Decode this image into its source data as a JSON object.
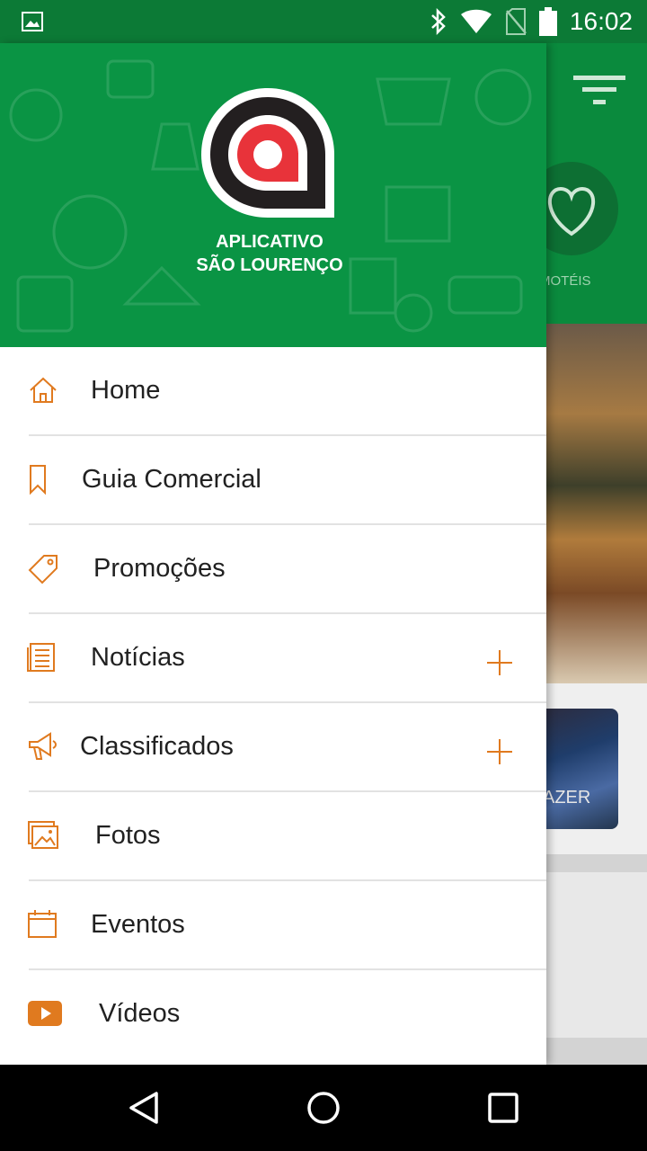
{
  "status_bar": {
    "time": "16:02",
    "icons": [
      "image-icon",
      "bluetooth-icon",
      "wifi-icon",
      "no-sim-icon",
      "battery-icon"
    ]
  },
  "background": {
    "category_label": "MOTÉIS",
    "card_label": "AZER"
  },
  "drawer": {
    "brand_line1": "APLICATIVO",
    "brand_line2": "SÃO LOURENÇO",
    "items": [
      {
        "label": "Home",
        "icon": "home-icon",
        "expandable": false
      },
      {
        "label": "Guia Comercial",
        "icon": "bookmark-icon",
        "expandable": false
      },
      {
        "label": "Promoções",
        "icon": "tag-icon",
        "expandable": false
      },
      {
        "label": "Notícias",
        "icon": "newspaper-icon",
        "expandable": true
      },
      {
        "label": "Classificados",
        "icon": "megaphone-icon",
        "expandable": true
      },
      {
        "label": "Fotos",
        "icon": "photos-icon",
        "expandable": false
      },
      {
        "label": "Eventos",
        "icon": "calendar-icon",
        "expandable": false
      },
      {
        "label": "Vídeos",
        "icon": "video-icon",
        "expandable": false
      }
    ]
  },
  "colors": {
    "header_green": "#0a9444",
    "status_green": "#0c7a36",
    "accent_orange": "#e07a1f",
    "logo_red": "#e8333a"
  }
}
